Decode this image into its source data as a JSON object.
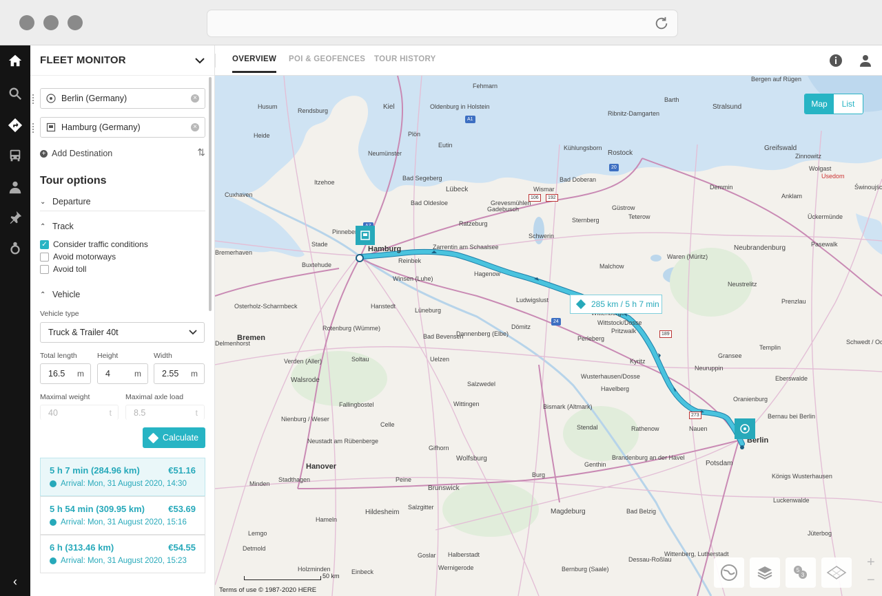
{
  "header": {
    "title": "FLEET MONITOR"
  },
  "tabs": [
    {
      "label": "OVERVIEW",
      "active": true
    },
    {
      "label": "POI & GEOFENCES",
      "active": false
    },
    {
      "label": "TOUR HISTORY",
      "active": false
    }
  ],
  "rail_icons": [
    "home-icon",
    "search-icon",
    "route-icon",
    "truck-icon",
    "driver-icon",
    "pin-icon",
    "location-icon"
  ],
  "locations": {
    "origin": "Berlin (Germany)",
    "destination": "Hamburg (Germany)"
  },
  "add_destination": "Add Destination",
  "tour_options": {
    "title": "Tour options",
    "departure": "Departure",
    "track": "Track",
    "checkboxes": [
      {
        "label": "Consider traffic conditions",
        "checked": true
      },
      {
        "label": "Avoid motorways",
        "checked": false
      },
      {
        "label": "Avoid toll",
        "checked": false
      }
    ],
    "vehicle": "Vehicle",
    "vehicle_type_label": "Vehicle type",
    "vehicle_type": "Truck & Trailer 40t",
    "total_length_label": "Total length",
    "total_length": "16.5",
    "height_label": "Height",
    "height": "4",
    "width_label": "Width",
    "width": "2.55",
    "unit": "m",
    "max_weight_label": "Maximal weight",
    "max_weight": "40",
    "max_axle_label": "Maximal axle load",
    "max_axle": "8.5",
    "weight_unit": "t"
  },
  "calculate": "Calculate",
  "results": [
    {
      "duration": "5 h 7 min (284.96 km)",
      "price": "€51.16",
      "arrival": "Arrival: Mon, 31 August 2020, 14:30",
      "active": true
    },
    {
      "duration": "5 h 54 min (309.95 km)",
      "price": "€53.69",
      "arrival": "Arrival: Mon, 31 August 2020, 15:16",
      "active": false
    },
    {
      "duration": "6 h (313.46 km)",
      "price": "€54.55",
      "arrival": "Arrival: Mon, 31 August 2020, 15:23",
      "active": false
    }
  ],
  "map": {
    "view_toggle": {
      "map": "Map",
      "list": "List"
    },
    "route_label": "285 km / 5 h 7 min",
    "scale": "50 km",
    "footer": "Terms of use    © 1987-2020 HERE",
    "route_color": "#4ac3de",
    "accent_color": "#27b4c4",
    "cities": [
      {
        "name": "Hamburg",
        "big": true
      },
      {
        "name": "Berlin",
        "big": true
      },
      {
        "name": "Bremen",
        "big": true
      },
      {
        "name": "Hanover",
        "big": true
      },
      {
        "name": "Rostock"
      },
      {
        "name": "Kiel"
      },
      {
        "name": "Lübeck"
      },
      {
        "name": "Schwerin"
      },
      {
        "name": "Wismar"
      },
      {
        "name": "Stralsund"
      },
      {
        "name": "Greifswald"
      },
      {
        "name": "Neubrandenburg"
      },
      {
        "name": "Potsdam"
      },
      {
        "name": "Magdeburg"
      },
      {
        "name": "Wolfsburg"
      },
      {
        "name": "Brunswick"
      },
      {
        "name": "Salzgitter"
      },
      {
        "name": "Hildesheim"
      },
      {
        "name": "Celle"
      },
      {
        "name": "Lüneburg"
      },
      {
        "name": "Uelzen"
      },
      {
        "name": "Stendal"
      },
      {
        "name": "Neuruppin"
      },
      {
        "name": "Perleberg"
      },
      {
        "name": "Ludwigslust"
      },
      {
        "name": "Gifhorn"
      },
      {
        "name": "Soltau"
      },
      {
        "name": "Nienburg / Weser"
      },
      {
        "name": "Oranienburg"
      },
      {
        "name": "Eberswalde"
      },
      {
        "name": "Güstrow"
      },
      {
        "name": "Bremerhaven"
      },
      {
        "name": "Cuxhaven"
      },
      {
        "name": "Stade"
      },
      {
        "name": "Pinneberg"
      },
      {
        "name": "Rendsburg"
      },
      {
        "name": "Neumünster"
      },
      {
        "name": "Brandenburg an der Havel"
      },
      {
        "name": "Rathenow"
      },
      {
        "name": "Nauen"
      },
      {
        "name": "Wittenberge"
      },
      {
        "name": "Pritzwalk"
      },
      {
        "name": "Havelberg"
      },
      {
        "name": "Salzwedel"
      },
      {
        "name": "Walsrode"
      },
      {
        "name": "Buxtehude"
      },
      {
        "name": "Winsen (Luhe)"
      },
      {
        "name": "Reinbek"
      },
      {
        "name": "Hagenow"
      },
      {
        "name": "Zarrentin am Schaalsee"
      },
      {
        "name": "Dömitz"
      },
      {
        "name": "Dannenberg (Elbe)"
      },
      {
        "name": "Wittstock/Dosse"
      },
      {
        "name": "Wusterhausen/Dosse"
      },
      {
        "name": "Kyritz"
      },
      {
        "name": "Bernau bei Berlin"
      },
      {
        "name": "Königs Wusterhausen"
      },
      {
        "name": "Bad Segeberg"
      },
      {
        "name": "Bad Oldesloe"
      },
      {
        "name": "Ratzeburg"
      },
      {
        "name": "Itzehoe"
      },
      {
        "name": "Eutin"
      },
      {
        "name": "Plön"
      },
      {
        "name": "Neustrelitz"
      },
      {
        "name": "Waren (Müritz)"
      },
      {
        "name": "Teterow"
      },
      {
        "name": "Prenzlau"
      },
      {
        "name": "Gransee"
      },
      {
        "name": "Templin"
      },
      {
        "name": "Heide"
      },
      {
        "name": "Husum"
      },
      {
        "name": "Dessau-Roßlau"
      },
      {
        "name": "Bernburg (Saale)"
      },
      {
        "name": "Halberstadt"
      },
      {
        "name": "Wernigerode"
      },
      {
        "name": "Goslar"
      },
      {
        "name": "Hameln"
      },
      {
        "name": "Minden"
      },
      {
        "name": "Verden (Aller)"
      },
      {
        "name": "Rotenburg (Wümme)"
      },
      {
        "name": "Osterholz-Scharmbeck"
      },
      {
        "name": "Delmenhorst"
      },
      {
        "name": "Peine"
      },
      {
        "name": "Burg"
      },
      {
        "name": "Genthin"
      },
      {
        "name": "Jüterbog"
      },
      {
        "name": "Luckenwalde"
      },
      {
        "name": "Bad Belzig"
      },
      {
        "name": "Wittenberg, Lutherstadt"
      },
      {
        "name": "Schwedt / Oder"
      },
      {
        "name": "Świnoujście"
      },
      {
        "name": "Usedom"
      },
      {
        "name": "Ückermünde"
      },
      {
        "name": "Pasewalk"
      },
      {
        "name": "Anklam"
      },
      {
        "name": "Demmin"
      },
      {
        "name": "Malchow"
      },
      {
        "name": "Sternberg"
      },
      {
        "name": "Gadebusch"
      },
      {
        "name": "Grevesmühlen"
      },
      {
        "name": "Kühlungsborn"
      },
      {
        "name": "Bergen auf Rügen"
      },
      {
        "name": "Fehmarn"
      },
      {
        "name": "Oldenburg in Holstein"
      },
      {
        "name": "Bad Doberan"
      },
      {
        "name": "Ribnitz-Damgarten"
      },
      {
        "name": "Barth"
      },
      {
        "name": "Zinnowitz"
      },
      {
        "name": "Wolgast"
      },
      {
        "name": "Hanstedt"
      },
      {
        "name": "Fallingbostel"
      },
      {
        "name": "Bad Bevensen"
      },
      {
        "name": "Wittingen"
      },
      {
        "name": "Bismark (Altmark)"
      },
      {
        "name": "Neustadt am Rübenberge"
      },
      {
        "name": "Stadthagen"
      },
      {
        "name": "Lemgo"
      },
      {
        "name": "Detmold"
      },
      {
        "name": "Holzminden"
      },
      {
        "name": "Einbeck"
      }
    ]
  }
}
